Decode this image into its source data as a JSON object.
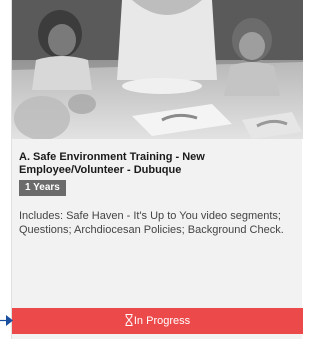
{
  "course": {
    "title": "A. Safe Environment Training - New Employee/Volunteer - Dubuque",
    "duration": "1 Years",
    "description": "Includes: Safe Haven - It's Up to You video segments; Questions; Archdiocesan Policies; Background Check.",
    "status_label": "In Progress",
    "status_icon": "hourglass-icon",
    "status_color": "#ec4a4a",
    "badge_color": "#6b6b6b"
  }
}
